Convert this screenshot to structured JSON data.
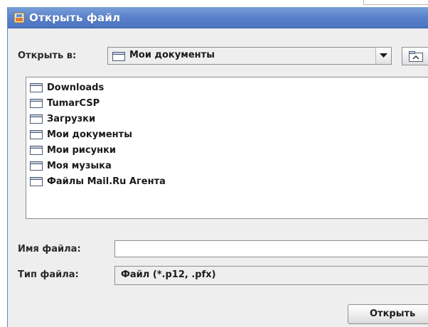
{
  "dialog": {
    "title": "Открыть файл",
    "icon": "java-app-icon"
  },
  "lookin": {
    "label": "Открыть в:",
    "value": "Мои документы",
    "value_icon": "folder-icon"
  },
  "file_list": {
    "items": [
      {
        "name": "Downloads",
        "icon": "folder-icon"
      },
      {
        "name": "TumarCSP",
        "icon": "folder-icon"
      },
      {
        "name": "Загрузки",
        "icon": "folder-icon"
      },
      {
        "name": "Мои документы",
        "icon": "folder-icon"
      },
      {
        "name": "Мои рисунки",
        "icon": "folder-icon"
      },
      {
        "name": "Моя музыка",
        "icon": "folder-icon"
      },
      {
        "name": "Файлы Mail.Ru Агента",
        "icon": "folder-icon"
      }
    ]
  },
  "filename": {
    "label": "Имя файла:",
    "value": ""
  },
  "filetype": {
    "label": "Тип файла:",
    "value": "Файл (*.p12, .pfx)"
  },
  "buttons": {
    "open_label": "Открыть"
  },
  "colors": {
    "titlebar": "#5c84cc",
    "dialog_bg": "#eeeeee",
    "list_bg": "#ffffff"
  }
}
